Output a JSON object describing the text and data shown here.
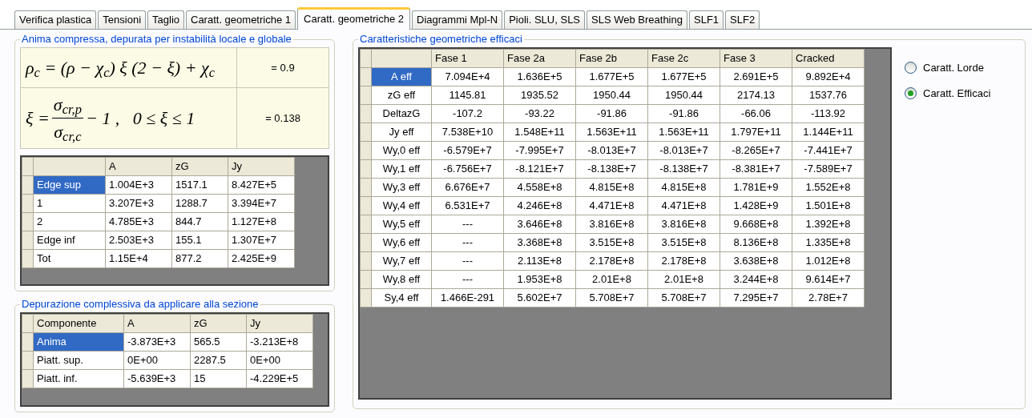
{
  "tabs": [
    {
      "label": "Verifica plastica",
      "selected": false
    },
    {
      "label": "Tensioni",
      "selected": false
    },
    {
      "label": "Taglio",
      "selected": false
    },
    {
      "label": "Caratt. geometriche 1",
      "selected": false
    },
    {
      "label": "Caratt. geometriche 2",
      "selected": true
    },
    {
      "label": "Diagrammi Mpl-N",
      "selected": false
    },
    {
      "label": "Pioli. SLU, SLS",
      "selected": false
    },
    {
      "label": "SLS Web Breathing",
      "selected": false
    },
    {
      "label": "SLF1",
      "selected": false
    },
    {
      "label": "SLF2",
      "selected": false
    }
  ],
  "web_group": {
    "title": "Anima compressa, depurata per instabilità locale e globale",
    "formulas": [
      {
        "kind": "line",
        "text": "ρ$_{c}$ = (ρ − χ$_{c}$) ξ (2 − ξ) + χ$_{c}$",
        "value": "= 0.9"
      },
      {
        "kind": "fraction",
        "lead": "ξ =",
        "numerator": "σ$_{cr,p}$",
        "denominator": "σ$_{cr,c}$",
        "tail": "− 1 ,   0 ≤ ξ ≤ 1",
        "value": "= 0.138"
      }
    ],
    "table": {
      "columns": [
        "",
        "A",
        "zG",
        "Jy"
      ],
      "rows": [
        {
          "cells": [
            "Edge sup",
            "1.004E+3",
            "1517.1",
            "8.427E+5"
          ],
          "selected": true
        },
        {
          "cells": [
            "1",
            "3.207E+3",
            "1288.7",
            "3.394E+7"
          ],
          "selected": false
        },
        {
          "cells": [
            "2",
            "4.785E+3",
            "844.7",
            "1.127E+8"
          ],
          "selected": false
        },
        {
          "cells": [
            "Edge inf",
            "2.503E+3",
            "155.1",
            "1.307E+7"
          ],
          "selected": false
        },
        {
          "cells": [
            "Tot",
            "1.15E+4",
            "877.2",
            "2.425E+9"
          ],
          "selected": false
        }
      ]
    }
  },
  "section_group": {
    "title": "Depurazione complessiva da applicare alla sezione",
    "table": {
      "columns": [
        "Componente",
        "A",
        "zG",
        "Jy"
      ],
      "rows": [
        {
          "cells": [
            "Anima",
            "-3.873E+3",
            "565.5",
            "-3.213E+8"
          ],
          "selected": true
        },
        {
          "cells": [
            "Piatt. sup.",
            "0E+00",
            "2287.5",
            "0E+00"
          ],
          "selected": false
        },
        {
          "cells": [
            "Piatt. inf.",
            "-5.639E+3",
            "15",
            "-4.229E+5"
          ],
          "selected": false
        }
      ]
    }
  },
  "effective_group": {
    "title": "Caratteristiche geometriche efficaci",
    "table": {
      "columns": [
        "",
        "Fase 1",
        "Fase 2a",
        "Fase 2b",
        "Fase 2c",
        "Fase 3",
        "Cracked"
      ],
      "rows": [
        {
          "cells": [
            "A eff",
            "7.094E+4",
            "1.636E+5",
            "1.677E+5",
            "1.677E+5",
            "2.691E+5",
            "9.892E+4"
          ],
          "selected": true
        },
        {
          "cells": [
            "zG eff",
            "1145.81",
            "1935.52",
            "1950.44",
            "1950.44",
            "2174.13",
            "1537.76"
          ],
          "selected": false
        },
        {
          "cells": [
            "DeltazG",
            "-107.2",
            "-93.22",
            "-91.86",
            "-91.86",
            "-66.06",
            "-113.92"
          ],
          "selected": false
        },
        {
          "cells": [
            "Jy eff",
            "7.538E+10",
            "1.548E+11",
            "1.563E+11",
            "1.563E+11",
            "1.797E+11",
            "1.144E+11"
          ],
          "selected": false
        },
        {
          "cells": [
            "Wy,0 eff",
            "-6.579E+7",
            "-7.995E+7",
            "-8.013E+7",
            "-8.013E+7",
            "-8.265E+7",
            "-7.441E+7"
          ],
          "selected": false
        },
        {
          "cells": [
            "Wy,1 eff",
            "-6.756E+7",
            "-8.121E+7",
            "-8.138E+7",
            "-8.138E+7",
            "-8.381E+7",
            "-7.589E+7"
          ],
          "selected": false
        },
        {
          "cells": [
            "Wy,3 eff",
            "6.676E+7",
            "4.558E+8",
            "4.815E+8",
            "4.815E+8",
            "1.781E+9",
            "1.552E+8"
          ],
          "selected": false
        },
        {
          "cells": [
            "Wy,4 eff",
            "6.531E+7",
            "4.246E+8",
            "4.471E+8",
            "4.471E+8",
            "1.428E+9",
            "1.501E+8"
          ],
          "selected": false
        },
        {
          "cells": [
            "Wy,5 eff",
            "---",
            "3.646E+8",
            "3.816E+8",
            "3.816E+8",
            "9.668E+8",
            "1.392E+8"
          ],
          "selected": false
        },
        {
          "cells": [
            "Wy,6 eff",
            "---",
            "3.368E+8",
            "3.515E+8",
            "3.515E+8",
            "8.136E+8",
            "1.335E+8"
          ],
          "selected": false
        },
        {
          "cells": [
            "Wy,7 eff",
            "---",
            "2.113E+8",
            "2.178E+8",
            "2.178E+8",
            "3.638E+8",
            "1.012E+8"
          ],
          "selected": false
        },
        {
          "cells": [
            "Wy,8 eff",
            "---",
            "1.953E+8",
            "2.01E+8",
            "2.01E+8",
            "3.244E+8",
            "9.614E+7"
          ],
          "selected": false
        },
        {
          "cells": [
            "Sy,4 eff",
            "1.466E-291",
            "5.602E+7",
            "5.708E+7",
            "5.708E+7",
            "7.295E+7",
            "2.78E+7"
          ],
          "selected": false
        }
      ]
    },
    "options": [
      {
        "label": "Caratt. Lorde",
        "selected": false
      },
      {
        "label": "Caratt. Efficaci",
        "selected": true
      }
    ]
  }
}
